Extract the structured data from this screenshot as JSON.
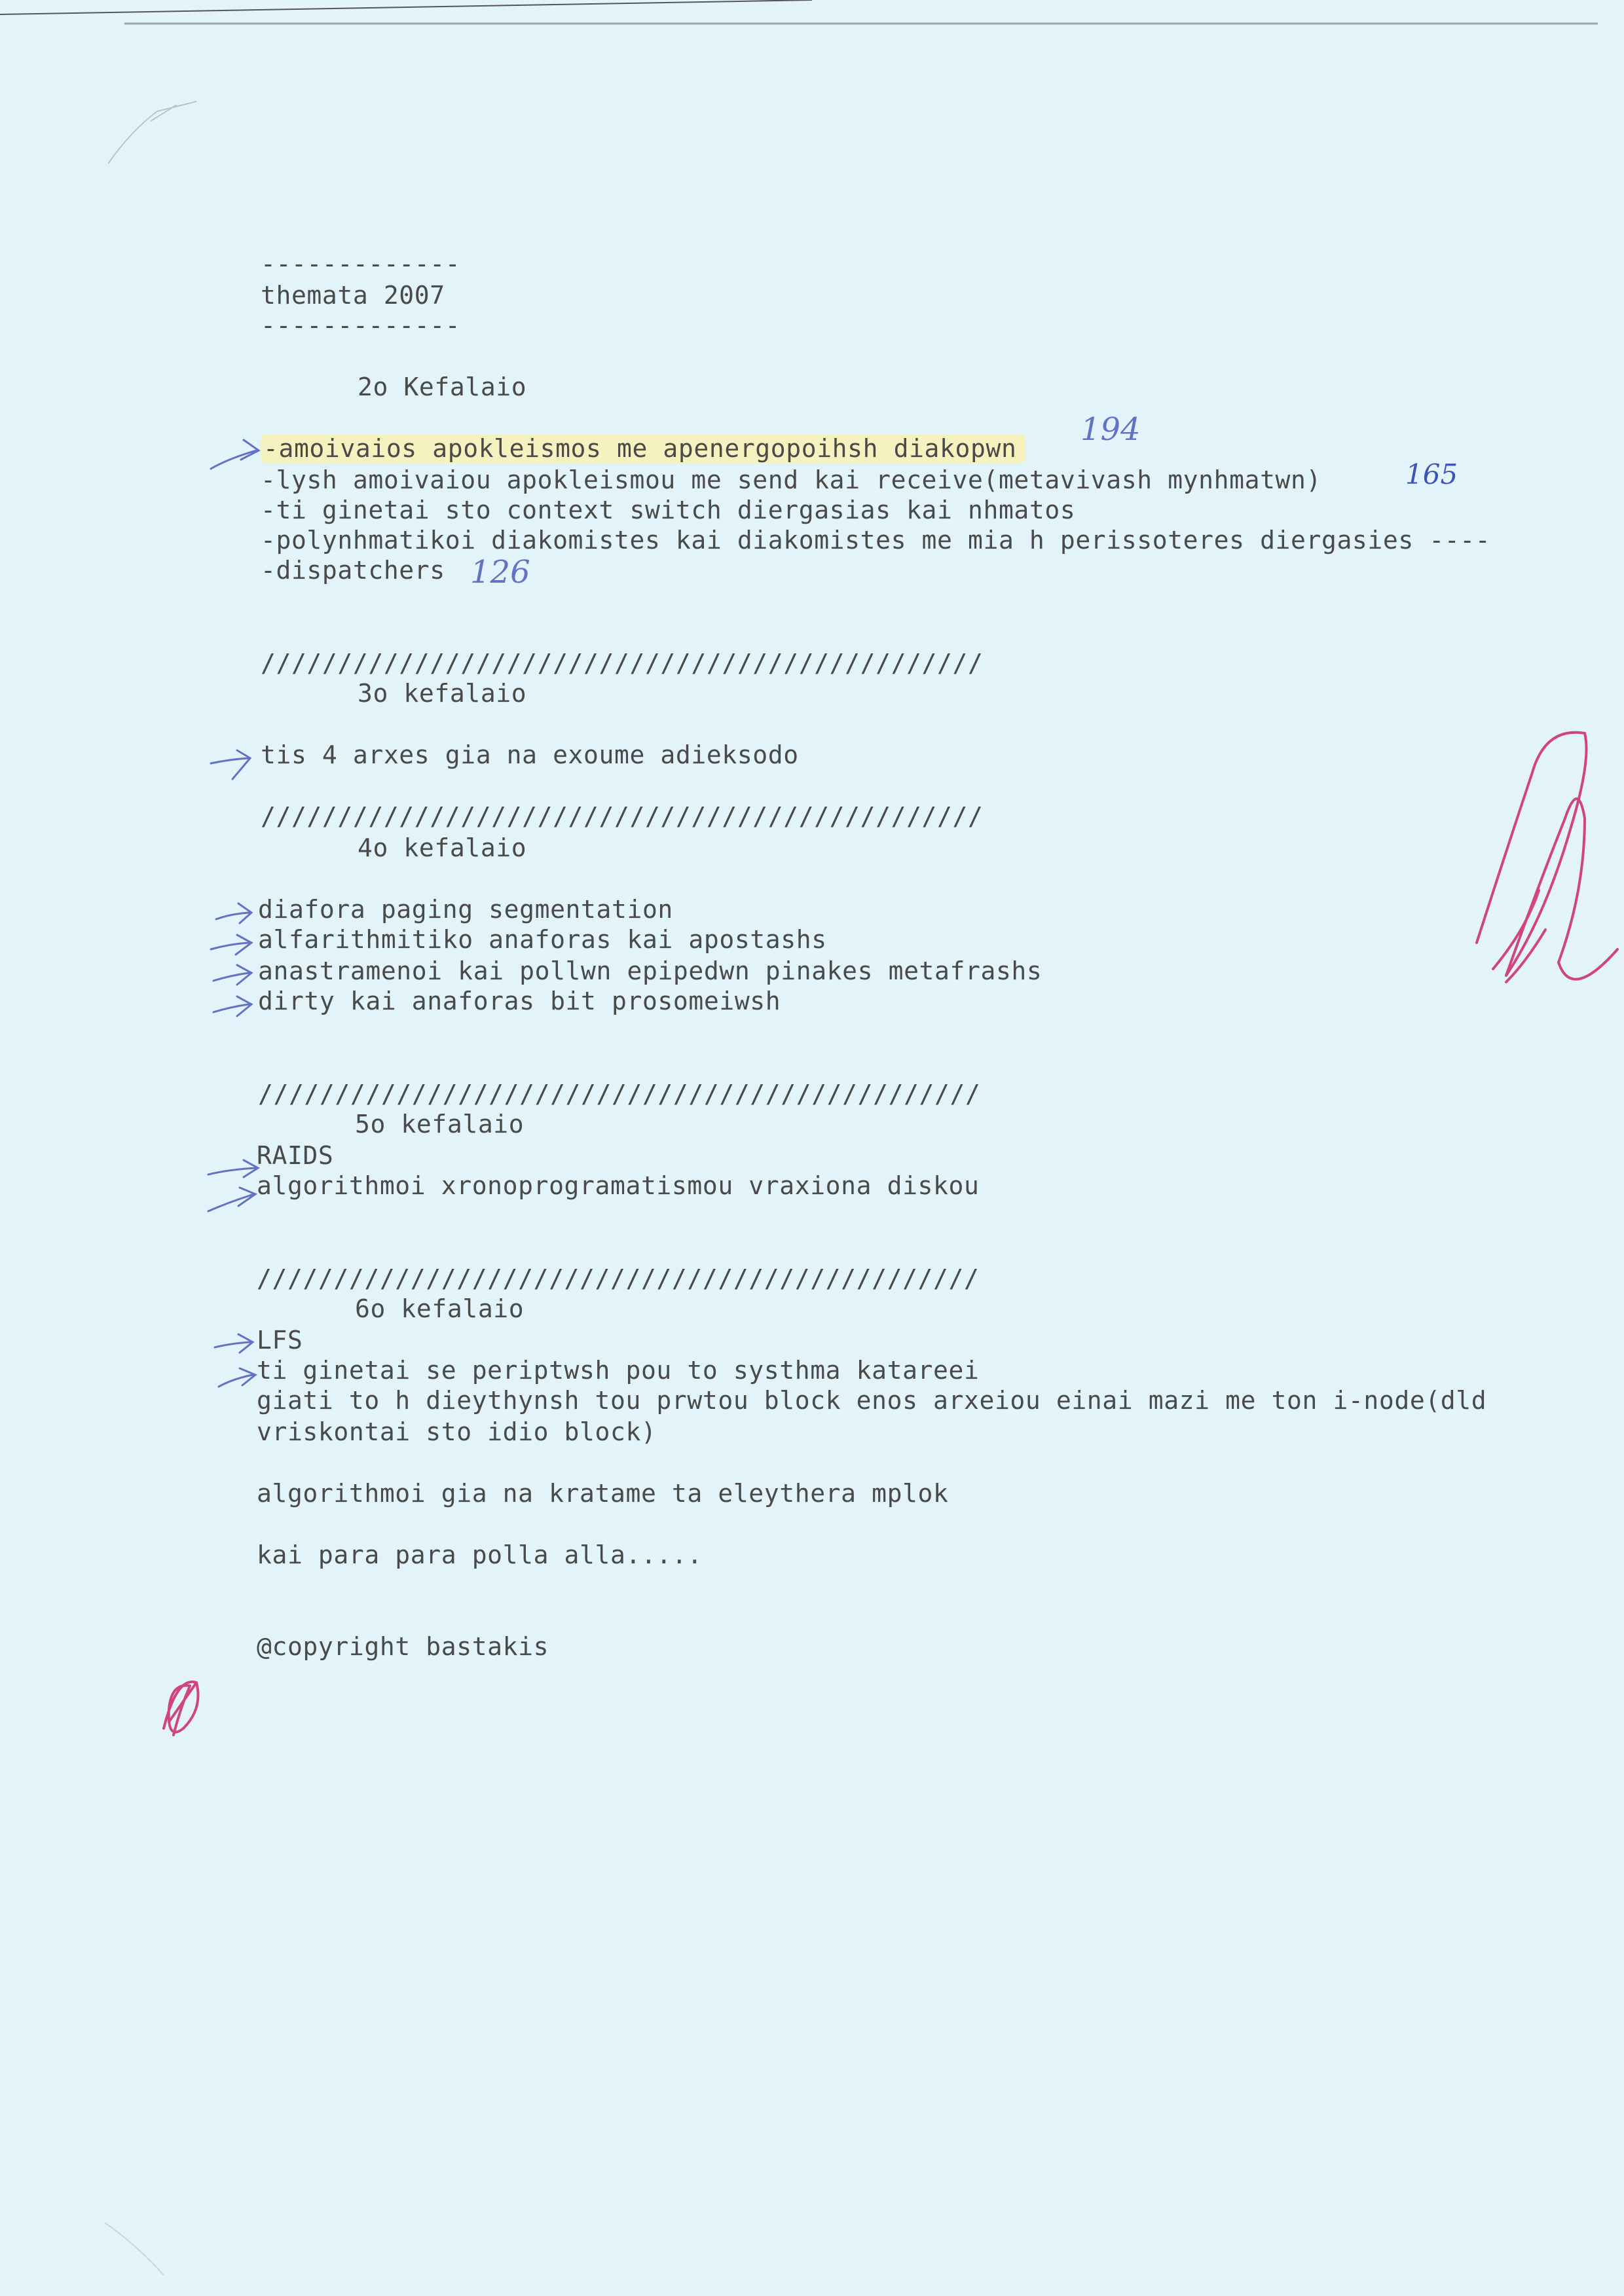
{
  "document": {
    "header": {
      "rule_top": "-------------",
      "title": "themata 2007",
      "rule_bottom": "-------------"
    },
    "sections": [
      {
        "heading": "2o Kefalaio",
        "items": [
          "-amoivaios apokleismos me apenergopoihsh diakopwn",
          "-lysh amoivaiou apokleismou me send kai receive(metavivash mynhmatwn)",
          "-ti ginetai sto context switch diergasias kai nhmatos",
          "-polynhmatikoi diakomistes kai diakomistes me mia h perissoteres diergasies ----",
          "-dispatchers"
        ]
      },
      {
        "divider": "///////////////////////////////////////////////",
        "heading": "3o kefalaio",
        "items": [
          "tis 4 arxes gia na exoume adieksodo"
        ]
      },
      {
        "divider": "///////////////////////////////////////////////",
        "heading": "4o kefalaio",
        "items": [
          "diafora paging segmentation",
          "alfarithmitiko anaforas kai apostashs",
          "anastramenoi kai pollwn epipedwn pinakes metafrashs",
          "dirty kai anaforas bit prosomeiwsh"
        ]
      },
      {
        "divider": "///////////////////////////////////////////////",
        "heading": "5o kefalaio",
        "items": [
          "RAIDS",
          "algorithmoi xronoprogramatismou vraxiona diskou"
        ]
      },
      {
        "divider": "///////////////////////////////////////////////",
        "heading": "6o kefalaio",
        "items": [
          "LFS",
          "ti ginetai se periptwsh pou to systhma katareei",
          "giati to h dieythynsh tou prwtou block enos arxeiou einai mazi me ton i-node(dld",
          "vriskontai sto idio block)",
          "algorithmoi gia na kratame ta eleythera mplok",
          "kai para para polla alla....."
        ]
      }
    ],
    "footer": "@copyright bastakis"
  },
  "annotations": {
    "page_ref_1": "194",
    "page_ref_2": "165",
    "page_ref_3": "126",
    "ink_colors": {
      "blue": "#6272c4",
      "pink": "#d0457e",
      "highlight": "#f6f2bf"
    }
  }
}
